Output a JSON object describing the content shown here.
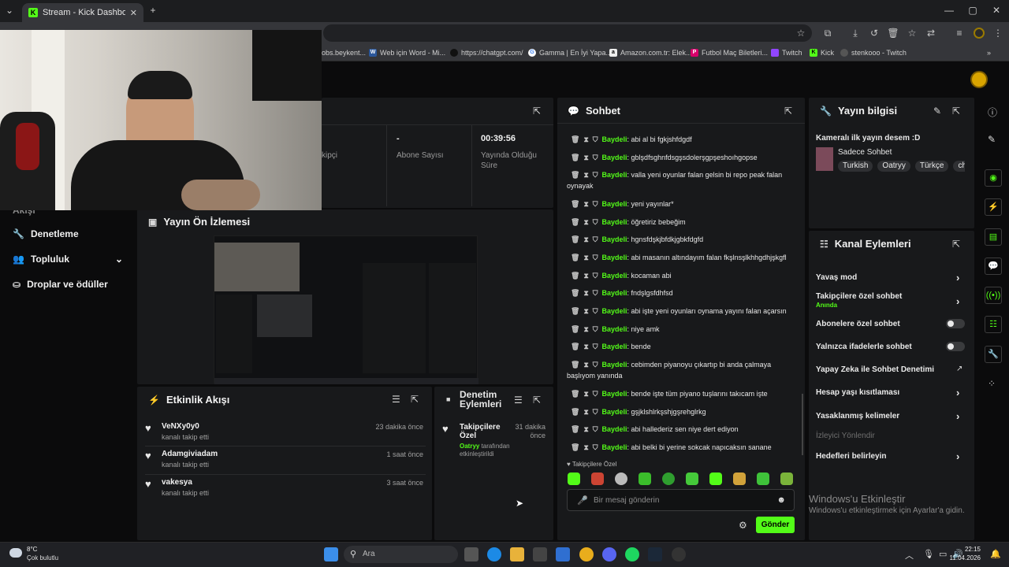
{
  "browser": {
    "tab_title": "Stream - Kick Dashboard",
    "bookmarks": [
      "obs.beykent...",
      "Web için Word - Mi...",
      "https://chatgpt.com/",
      "Gamma | En İyi Yapa...",
      "Amazon.com.tr: Elek...",
      "Futbol Maç Biletleri...",
      "Twitch",
      "Kick",
      "stenkooo - Twitch"
    ]
  },
  "sidebar": {
    "partial_item": "Akışı",
    "items": [
      {
        "label": "Denetleme",
        "icon": "wrench-icon"
      },
      {
        "label": "Topluluk",
        "icon": "community-icon"
      },
      {
        "label": "Droplar ve ödüller",
        "icon": "drops-icon"
      }
    ]
  },
  "stats": {
    "follower_label_partial": "kipçi",
    "subscriber_value": "-",
    "subscriber_label": "Abone Sayısı",
    "live_value": "00:39:56",
    "live_label_1": "Yayında Olduğu",
    "live_label_2": "Süre"
  },
  "preview": {
    "title": "Yayın Ön İzlemesi"
  },
  "activity": {
    "title": "Etkinlik Akışı",
    "items": [
      {
        "name": "VeNXy0y0",
        "sub": "kanalı takip etti",
        "time": "23 dakika önce"
      },
      {
        "name": "Adamgiviadam",
        "sub": "kanalı takip etti",
        "time": "1 saat önce"
      },
      {
        "name": "vakesya",
        "sub": "kanalı takip etti",
        "time": "3 saat önce"
      }
    ]
  },
  "moderation": {
    "title_1": "Denetim",
    "title_2": "Eylemleri",
    "item_title_1": "Takipçilere",
    "item_title_2": "Özel",
    "item_time_1": "31 dakika",
    "item_time_2": "önce",
    "item_user": "Oatryy",
    "item_desc_1": " tarafından",
    "item_desc_2": "etkinleştirildi"
  },
  "chat": {
    "title": "Sohbet",
    "messages": [
      {
        "user": "Baydeli",
        "text": ": abi al bi fgkjshfdgdf"
      },
      {
        "user": "Baydeli",
        "text": ": gblşdfsghnfdsgşsdolerşgpşeshoıhgopse"
      },
      {
        "user": "Baydeli",
        "text": ": valla yeni oyunlar falan gelsin bi repo peak falan oynayak"
      },
      {
        "user": "Baydeli",
        "text": ": yeni yayınlar*"
      },
      {
        "user": "Baydeli",
        "text": ": öğretiriz bebeğim"
      },
      {
        "user": "Baydeli",
        "text": ": hgnsfdşkjbfdkjgbkfdgfd"
      },
      {
        "user": "Baydeli",
        "text": ": abi masanın altındayım falan fkşlnsşlkhhgdhjşkgfl"
      },
      {
        "user": "Baydeli",
        "text": ": kocaman abi"
      },
      {
        "user": "Baydeli",
        "text": ": fndşlgsfdhfsd"
      },
      {
        "user": "Baydeli",
        "text": ": abi işte yeni oyunları oynama yayını falan açarsın"
      },
      {
        "user": "Baydeli",
        "text": ": niye amk"
      },
      {
        "user": "Baydeli",
        "text": ": bende"
      },
      {
        "user": "Baydeli",
        "text": ": cebimden piyanoyu çıkartıp bi anda çalmaya başlıyom yanında"
      },
      {
        "user": "Baydeli",
        "text": ": bende işte tüm piyano tuşlarını takıcam işte"
      },
      {
        "user": "Baydeli",
        "text": ": gşjklshlrkşshjgşrehglrkg"
      },
      {
        "user": "Baydeli",
        "text": ": abi hallederiz sen niye dert ediyon"
      },
      {
        "user": "Baydeli",
        "text": ": abi belki bi yerine sokcak napıcaksın sanane"
      }
    ],
    "mode_label": "Takipçilere Özel",
    "input_placeholder": "Bir mesaj gönderin",
    "send_label": "Gönder"
  },
  "stream_info": {
    "title": "Yayın bilgisi",
    "stream_title": "Kameralı ilk yayın desem :D",
    "category": "Sadece Sohbet",
    "tags": [
      "Turkish",
      "Oatryy",
      "Türkçe",
      "chil"
    ]
  },
  "channel_actions": {
    "title": "Kanal Eylemleri",
    "slow_mode": "Yavaş mod",
    "followers_only": "Takipçilere özel sohbet",
    "followers_only_status": "Anında",
    "subs_only": "Abonelere özel sohbet",
    "emotes_only": "Yalnızca ifadelerle sohbet",
    "ai_moderation": "Yapay Zeka ile Sohbet Denetimi",
    "account_age": "Hesap yaşı kısıtlaması",
    "banned_words": "Yasaklanmış kelimeler",
    "viewer_redirect": "İzleyici Yönlendir",
    "goals": "Hedefleri belirleyin"
  },
  "watermark": {
    "line1": "Windows'u Etkinleştir",
    "line2": "Windows'u etkinleştirmek için Ayarlar'a gidin."
  },
  "taskbar": {
    "weather_temp": "8°C",
    "weather_desc": "Çok bulutlu",
    "search_placeholder": "Ara",
    "time": "22:15",
    "date": "11.04.2026"
  },
  "colors": {
    "accent": "#53fc18",
    "panel": "#18191b",
    "background": "#0b0b0c"
  }
}
